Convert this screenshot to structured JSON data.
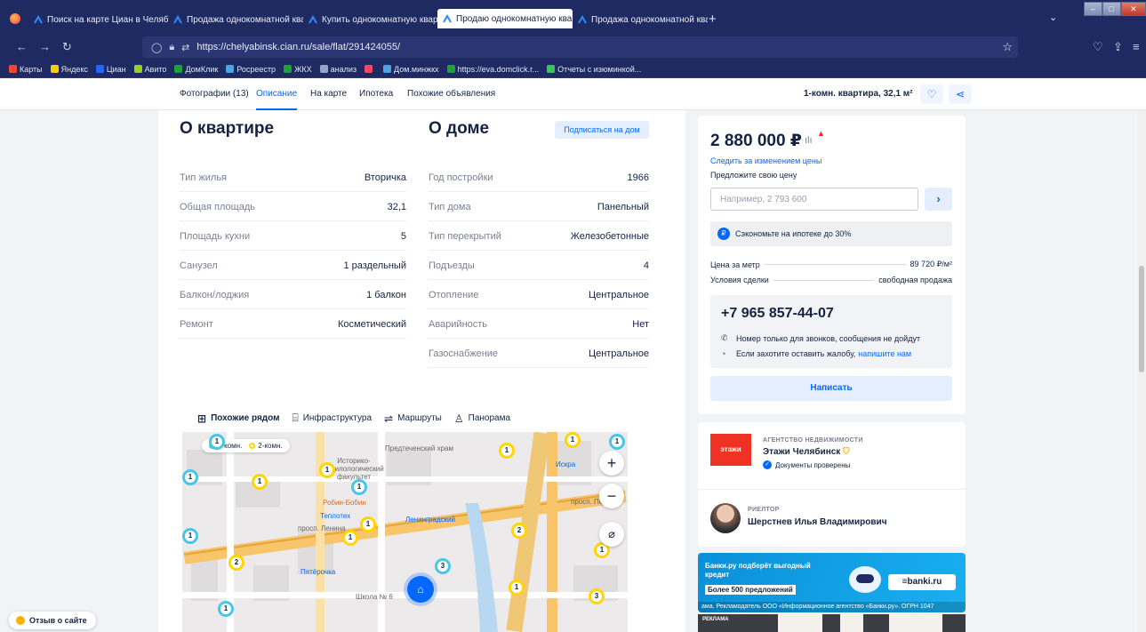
{
  "browser": {
    "tabs": [
      {
        "title": "Поиск на карте Циан в Челяб"
      },
      {
        "title": "Продажа однокомнатной квар"
      },
      {
        "title": "Купить однокомнатную кварт"
      },
      {
        "title": "Продаю однокомнатную квар"
      },
      {
        "title": "Продажа однокомнатной квар"
      }
    ],
    "active_tab": 3,
    "url": "https://chelyabinsk.cian.ru/sale/flat/291424055/",
    "bookmarks": [
      {
        "label": "Карты",
        "color": "#ff4433"
      },
      {
        "label": "Яндекс",
        "color": "#ffcc00"
      },
      {
        "label": "Циан",
        "color": "#2266ff"
      },
      {
        "label": "Авито",
        "color": "#97cf26"
      },
      {
        "label": "ДомКлик",
        "color": "#21a038"
      },
      {
        "label": "Росреестр",
        "color": "#4fa3e0"
      },
      {
        "label": "ЖКХ",
        "color": "#21a038"
      },
      {
        "label": "анализ",
        "color": "#9aa3c8"
      },
      {
        "label": "",
        "color": "#ff4466"
      },
      {
        "label": "Дом.минжкх",
        "color": "#4fa3e0"
      },
      {
        "label": "https://eva.domclick.r...",
        "color": "#21a038"
      },
      {
        "label": "Отчеты с изюминкой...",
        "color": "#34c759"
      }
    ]
  },
  "subnav": {
    "items": [
      "Фотографии (13)",
      "Описание",
      "На карте",
      "Ипотека",
      "Похожие объявления"
    ],
    "active": 1,
    "summary": "1-комн. квартира, 32,1 м²"
  },
  "apartment": {
    "title": "О квартире",
    "rows": [
      {
        "key": "Тип жилья",
        "value": "Вторичка"
      },
      {
        "key": "Общая площадь",
        "value": "32,1"
      },
      {
        "key": "Площадь кухни",
        "value": "5"
      },
      {
        "key": "Санузел",
        "value": "1 раздельный"
      },
      {
        "key": "Балкон/лоджия",
        "value": "1 балкон"
      },
      {
        "key": "Ремонт",
        "value": "Косметический"
      }
    ]
  },
  "house": {
    "title": "О доме",
    "subscribe_label": "Подписаться на дом",
    "rows": [
      {
        "key": "Год постройки",
        "value": "1966"
      },
      {
        "key": "Тип дома",
        "value": "Панельный"
      },
      {
        "key": "Тип перекрытий",
        "value": "Железобетонные"
      },
      {
        "key": "Подъезды",
        "value": "4"
      },
      {
        "key": "Отопление",
        "value": "Центральное"
      },
      {
        "key": "Аварийность",
        "value": "Нет"
      },
      {
        "key": "Газоснабжение",
        "value": "Центральное"
      }
    ]
  },
  "map": {
    "tabs": [
      "Похожие рядом",
      "Инфраструктура",
      "Маршруты",
      "Панорама"
    ],
    "active_tab": 0,
    "legend": {
      "one_room": "1-комн.",
      "two_room": "2-комн."
    },
    "labels": {
      "church": "Предтеченский храм",
      "faculty": "Историко-филологический факультет",
      "cafe": "Робин-Бобин",
      "street1": "просп. Победы",
      "street2": "просп. Ленина",
      "iskra": "Искра",
      "school": "Школа № 6",
      "store": "Пятёрочка",
      "teplotex": "Теплотех",
      "leningrad": "Ленинградский"
    },
    "pins": [
      {
        "n": "1"
      },
      {
        "n": "1"
      },
      {
        "n": "1"
      },
      {
        "n": "1"
      },
      {
        "n": "1"
      },
      {
        "n": "1"
      },
      {
        "n": "1"
      },
      {
        "n": "1"
      },
      {
        "n": "2"
      },
      {
        "n": "2"
      },
      {
        "n": "3"
      },
      {
        "n": "1"
      },
      {
        "n": "3"
      },
      {
        "n": "1"
      },
      {
        "n": "1"
      },
      {
        "n": "1"
      },
      {
        "n": "1"
      },
      {
        "n": "1"
      }
    ]
  },
  "pricing": {
    "price": "2 880 000 ₽",
    "follow_label": "Следить за изменением цены",
    "offer_label": "Предложите свою цену",
    "offer_placeholder": "Например, 2 793 600",
    "mortgage_note": "Сэкономьте на ипотеке до 30%",
    "price_per_meter_label": "Цена за метр",
    "price_per_meter_value": "89 720 ₽/м²",
    "deal_terms_label": "Условия сделки",
    "deal_terms_value": "свободная продажа",
    "phone": "+7 965 857-44-07",
    "phone_note": "Номер только для звонков, сообщения не дойдут",
    "complaint_text": "Если захотите оставить жалобу,",
    "complaint_link": "напишите нам",
    "write_label": "Написать"
  },
  "agent": {
    "agency_logo_text": "этажи",
    "agency_type": "АГЕНТСТВО НЕДВИЖИМОСТИ",
    "agency_name": "Этажи Челябинск",
    "verified": "Документы проверены",
    "realtor_type": "РИЕЛТОР",
    "realtor_name": "Шерстнев Илья Владимирович"
  },
  "ad": {
    "text": "Банки.ру подберёт выгодный кредит",
    "tag": "Более 500 предложений",
    "logo": "≡banki.ru",
    "legal": "ама. Рекламодатель ООО «Информационное агентство «Банки.ру». ОГРН 1047",
    "ad2_tag": "РЕКЛАМА"
  },
  "feedback_label": "Отзыв о сайте"
}
